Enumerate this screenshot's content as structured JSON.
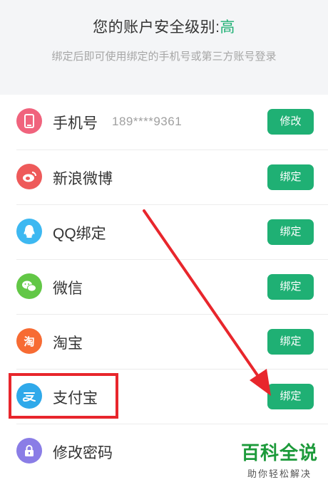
{
  "header": {
    "title_prefix": "您的账户安全级别:",
    "level": "高",
    "subtitle": "绑定后即可使用绑定的手机号或第三方账号登录"
  },
  "rows": [
    {
      "label": "手机号",
      "extra": "189****9361",
      "button": "修改",
      "icon": "phone-icon",
      "color": "#f0637d"
    },
    {
      "label": "新浪微博",
      "button": "绑定",
      "icon": "weibo-icon",
      "color": "#ee5a5a"
    },
    {
      "label": "QQ绑定",
      "button": "绑定",
      "icon": "qq-icon",
      "color": "#3db8f1"
    },
    {
      "label": "微信",
      "button": "绑定",
      "icon": "wechat-icon",
      "color": "#62c746"
    },
    {
      "label": "淘宝",
      "button": "绑定",
      "icon": "taobao-icon",
      "color": "#f76b33",
      "icon_text": "淘"
    },
    {
      "label": "支付宝",
      "button": "绑定",
      "icon": "alipay-icon",
      "color": "#2fa9ea"
    },
    {
      "label": "修改密码",
      "icon": "lock-icon",
      "color": "#8a7de6"
    }
  ],
  "watermark": {
    "main": "百科全说",
    "sub": "助你轻松解决"
  },
  "colors": {
    "accent": "#1fb074",
    "highlight": "#e8262c"
  }
}
